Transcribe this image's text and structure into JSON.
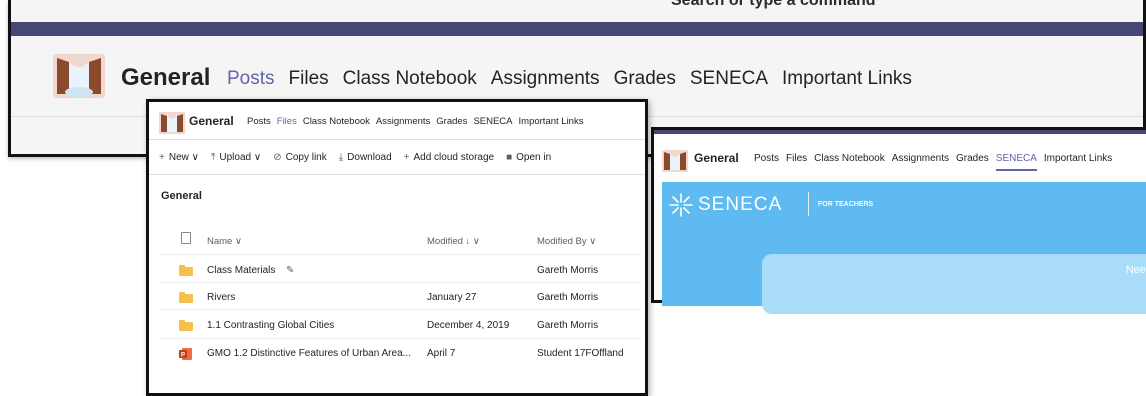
{
  "panel1": {
    "search_text": "Search or type a command",
    "title": "General",
    "tabs": [
      "Posts",
      "Files",
      "Class Notebook",
      "Assignments",
      "Grades",
      "SENECA",
      "Important Links"
    ]
  },
  "panel2": {
    "title": "General",
    "tabs": [
      "Posts",
      "Files",
      "Class Notebook",
      "Assignments",
      "Grades",
      "SENECA",
      "Important Links"
    ],
    "commands": [
      {
        "icon": "+",
        "label": "New",
        "chevron": true
      },
      {
        "icon": "⤒",
        "label": "Upload",
        "chevron": true
      },
      {
        "icon": "⊘",
        "label": "Copy link",
        "chevron": false
      },
      {
        "icon": "⤓",
        "label": "Download",
        "chevron": false
      },
      {
        "icon": "+",
        "label": "Add cloud storage",
        "chevron": false
      },
      {
        "icon": "■",
        "label": "Open in",
        "chevron": false
      }
    ],
    "breadcrumb": "General",
    "columns": {
      "name": "Name ∨",
      "modified": "Modified ↓ ∨",
      "modified_by": "Modified By ∨"
    },
    "files": [
      {
        "name": "Class Materials",
        "modified": "",
        "modified_by": "Gareth Morris",
        "type": "folder-locked"
      },
      {
        "name": "Rivers",
        "modified": "January 27",
        "modified_by": "Gareth Morris",
        "type": "folder"
      },
      {
        "name": "1.1 Contrasting Global Cities",
        "modified": "December 4, 2019",
        "modified_by": "Gareth Morris",
        "type": "folder"
      },
      {
        "name": "GMO 1.2 Distinctive Features of Urban Area...",
        "modified": "April 7",
        "modified_by": "Student 17FOffland",
        "type": "pptx"
      }
    ]
  },
  "panel3": {
    "title": "General",
    "tabs": [
      "Posts",
      "Files",
      "Class Notebook",
      "Assignments",
      "Grades",
      "SENECA",
      "Important Links"
    ],
    "brand_name": "SENECA",
    "brand_sub": "FOR TEACHERS",
    "card_text": "Need"
  },
  "colors": {
    "teams_purple": "#464775",
    "accent": "#6264a7",
    "seneca_blue": "#5ebaf0",
    "folder": "#f4c04e"
  }
}
